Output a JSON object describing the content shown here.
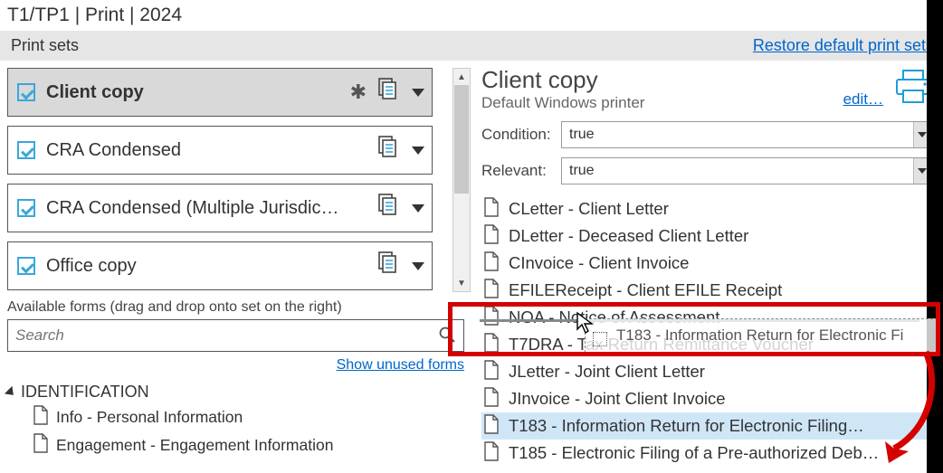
{
  "title": "T1/TP1 | Print | 2024",
  "subheader": {
    "label": "Print sets",
    "restore_link": "Restore default print sets"
  },
  "print_sets": [
    {
      "label": "Client copy",
      "starred": true
    },
    {
      "label": "CRA Condensed",
      "starred": false
    },
    {
      "label": "CRA Condensed (Multiple Jurisdic…",
      "starred": false
    },
    {
      "label": "Office copy",
      "starred": false
    }
  ],
  "available": {
    "hint": "Available forms (drag and drop onto set on the right)",
    "search_placeholder": "Search",
    "show_unused": "Show unused forms",
    "group_label": "IDENTIFICATION",
    "items": [
      "Info - Personal Information",
      "Engagement - Engagement Information"
    ]
  },
  "right": {
    "title": "Client copy",
    "subtitle": "Default Windows printer",
    "edit": "edit…",
    "condition_label": "Condition:",
    "condition_value": "true",
    "relevant_label": "Relevant:",
    "relevant_value": "true"
  },
  "form_list": [
    "CLetter - Client Letter",
    "DLetter - Deceased Client Letter",
    "CInvoice - Client Invoice",
    "EFILEReceipt - Client EFILE Receipt",
    "NOA - Notice of Assessment",
    "T7DRA - Tax Return Remittance Voucher",
    "JLetter - Joint Client Letter",
    "JInvoice - Joint Client Invoice",
    "T183 - Information Return for Electronic Filing…",
    "T185 - Electronic Filing of a Pre-authorized Deb…"
  ],
  "selected_form_index": 8,
  "drag_ghost_label": "T183 - Information Return for Electronic Fi"
}
